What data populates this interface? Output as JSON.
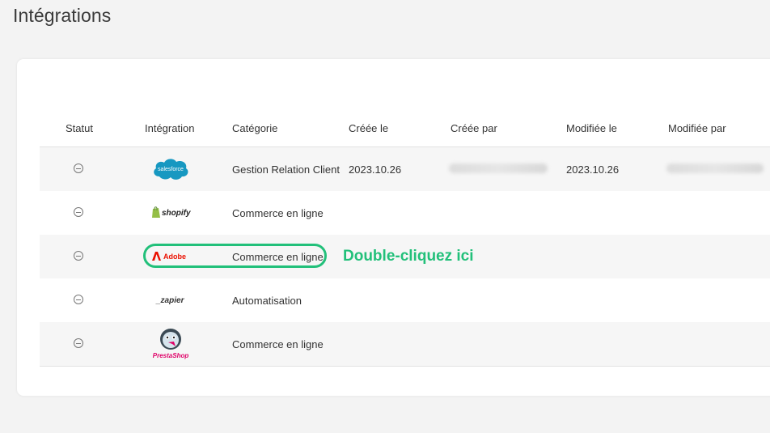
{
  "page": {
    "title": "Intégrations"
  },
  "table": {
    "headers": [
      "Statut",
      "Intégration",
      "Catégorie",
      "Créée le",
      "Créée par",
      "Modifiée le",
      "Modifiée par"
    ],
    "rows": [
      {
        "integration": "salesforce",
        "logo_text": "salesforce",
        "category": "Gestion Relation Client",
        "created_on": "2023.10.26",
        "modified_on": "2023.10.26"
      },
      {
        "integration": "shopify",
        "logo_text": "shopify",
        "category": "Commerce en ligne",
        "created_on": "",
        "modified_on": ""
      },
      {
        "integration": "adobe",
        "logo_text": "Adobe",
        "category": "Commerce en ligne",
        "created_on": "",
        "modified_on": ""
      },
      {
        "integration": "zapier",
        "logo_text": "_zapier",
        "category": "Automatisation",
        "created_on": "",
        "modified_on": ""
      },
      {
        "integration": "prestashop",
        "logo_text": "PrestaShop",
        "category": "Commerce en ligne",
        "created_on": "",
        "modified_on": ""
      }
    ]
  },
  "annotation": {
    "hint": "Double-cliquez ici"
  },
  "colors": {
    "accent": "#22c07a",
    "salesforce": "#1798c1",
    "shopify": "#95bf47",
    "adobe": "#eb1000",
    "prestashop": "#df0067"
  }
}
